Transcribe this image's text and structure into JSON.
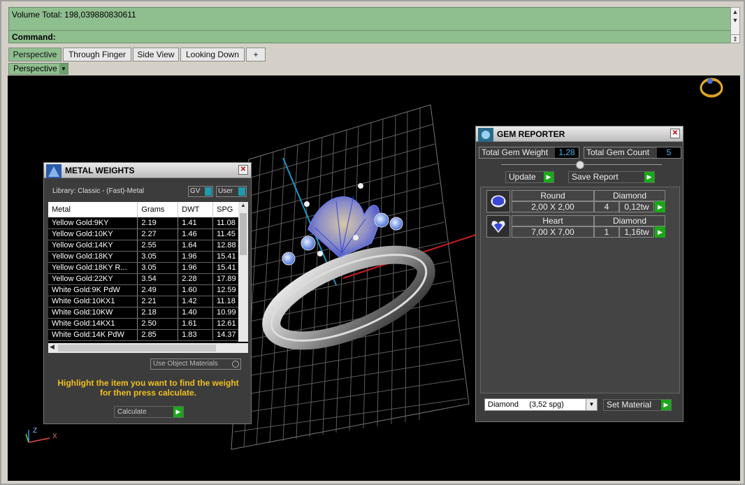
{
  "command": {
    "volume_total": "Volume Total: 198,039880830611",
    "command_label": "Command:"
  },
  "tabs": [
    "Perspective",
    "Through Finger",
    "Side View",
    "Looking Down",
    "+"
  ],
  "viewport_button": "Perspective",
  "axes": {
    "z": "Z",
    "x": "X"
  },
  "metal_weights": {
    "title": "METAL WEIGHTS",
    "library": "Library: Classic - (Fast)-Metal",
    "gv_label": "GV",
    "user_label": "User",
    "columns": [
      "Metal",
      "Grams",
      "DWT",
      "SPG"
    ],
    "rows": [
      [
        "Yellow Gold:9KY",
        "2.19",
        "1.41",
        "11.08"
      ],
      [
        "Yellow Gold:10KY",
        "2.27",
        "1.46",
        "11.45"
      ],
      [
        "Yellow Gold:14KY",
        "2.55",
        "1.64",
        "12.88"
      ],
      [
        "Yellow Gold:18KY",
        "3.05",
        "1.96",
        "15.41"
      ],
      [
        "Yellow Gold:18KY R...",
        "3.05",
        "1.96",
        "15.41"
      ],
      [
        "Yellow Gold:22KY",
        "3.54",
        "2.28",
        "17.89"
      ],
      [
        "White Gold:9K PdW",
        "2.49",
        "1.60",
        "12.59"
      ],
      [
        "White Gold:10KX1",
        "2.21",
        "1.42",
        "11.18"
      ],
      [
        "White Gold:10KW",
        "2.18",
        "1.40",
        "10.99"
      ],
      [
        "White Gold:14KX1",
        "2.50",
        "1.61",
        "12.61"
      ],
      [
        "White Gold:14K PdW",
        "2.85",
        "1.83",
        "14.37"
      ]
    ],
    "use_object_materials": "Use Object Materials",
    "hint": "Highlight the item you want to find the weight for then press calculate.",
    "calculate": "Calculate"
  },
  "gem_reporter": {
    "title": "GEM REPORTER",
    "total_weight_label": "Total Gem Weight",
    "total_weight_value": "1,28",
    "total_count_label": "Total Gem Count",
    "total_count_value": "5",
    "update": "Update",
    "save_report": "Save Report",
    "gems": [
      {
        "shape": "Round",
        "material": "Diamond",
        "size": "2,00 X 2,00",
        "count": "4",
        "weight": "0,12tw"
      },
      {
        "shape": "Heart",
        "material": "Diamond",
        "size": "7,00 X 7,00",
        "count": "1",
        "weight": "1,16tw"
      }
    ],
    "material_select": "Diamond     (3,52 spg)",
    "set_material": "Set Material"
  }
}
